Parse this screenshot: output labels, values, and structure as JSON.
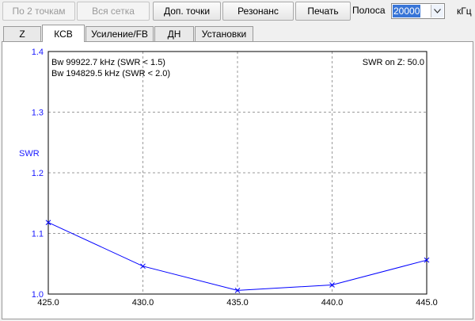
{
  "toolbar": {
    "by_2_points": "По 2 точкам",
    "full_grid": "Вся сетка",
    "extra_points": "Доп. точки",
    "resonance": "Резонанс",
    "print": "Печать",
    "band_label": "Полоса",
    "band_value": "20000",
    "band_unit": "кГц"
  },
  "tabs": [
    "Z",
    "КСВ",
    "Усиление/FB",
    "ДН",
    "Установки"
  ],
  "active_tab": "КСВ",
  "colors": {
    "series": "#0000ff",
    "grid": "#9a9a9a",
    "axis_label": "#1a1aff",
    "selection": "#3875d7"
  },
  "icons": {
    "band_dropdown": "chevron-down-icon"
  },
  "chart_data": {
    "type": "line",
    "ylabel": "SWR",
    "annotations": {
      "bw1": "Bw 99922.7 kHz (SWR < 1.5)",
      "bw2": "Bw 194829.5 kHz (SWR < 2.0)",
      "swr_on_z": "SWR on Z: 50.0"
    },
    "xlim": [
      425.0,
      445.0
    ],
    "ylim": [
      1.0,
      1.4
    ],
    "x_ticks": [
      "425.0",
      "430.0",
      "435.0",
      "440.0",
      "445.0"
    ],
    "y_ticks": [
      "1.0",
      "1.1",
      "1.2",
      "1.3",
      "1.4"
    ],
    "grid": true,
    "series": [
      {
        "x": [
          425.0,
          430.0,
          435.0,
          440.0,
          445.0
        ],
        "values": [
          1.118,
          1.046,
          1.006,
          1.015,
          1.056
        ]
      }
    ]
  }
}
